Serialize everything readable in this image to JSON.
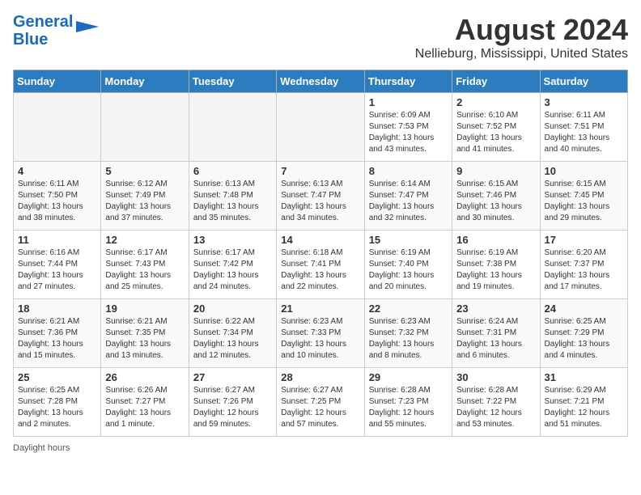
{
  "header": {
    "logo_line1": "General",
    "logo_line2": "Blue",
    "main_title": "August 2024",
    "subtitle": "Nellieburg, Mississippi, United States"
  },
  "footer": {
    "daylight_label": "Daylight hours"
  },
  "days_of_week": [
    "Sunday",
    "Monday",
    "Tuesday",
    "Wednesday",
    "Thursday",
    "Friday",
    "Saturday"
  ],
  "weeks": [
    [
      {
        "day": "",
        "info": ""
      },
      {
        "day": "",
        "info": ""
      },
      {
        "day": "",
        "info": ""
      },
      {
        "day": "",
        "info": ""
      },
      {
        "day": "1",
        "info": "Sunrise: 6:09 AM\nSunset: 7:53 PM\nDaylight: 13 hours\nand 43 minutes."
      },
      {
        "day": "2",
        "info": "Sunrise: 6:10 AM\nSunset: 7:52 PM\nDaylight: 13 hours\nand 41 minutes."
      },
      {
        "day": "3",
        "info": "Sunrise: 6:11 AM\nSunset: 7:51 PM\nDaylight: 13 hours\nand 40 minutes."
      }
    ],
    [
      {
        "day": "4",
        "info": "Sunrise: 6:11 AM\nSunset: 7:50 PM\nDaylight: 13 hours\nand 38 minutes."
      },
      {
        "day": "5",
        "info": "Sunrise: 6:12 AM\nSunset: 7:49 PM\nDaylight: 13 hours\nand 37 minutes."
      },
      {
        "day": "6",
        "info": "Sunrise: 6:13 AM\nSunset: 7:48 PM\nDaylight: 13 hours\nand 35 minutes."
      },
      {
        "day": "7",
        "info": "Sunrise: 6:13 AM\nSunset: 7:47 PM\nDaylight: 13 hours\nand 34 minutes."
      },
      {
        "day": "8",
        "info": "Sunrise: 6:14 AM\nSunset: 7:47 PM\nDaylight: 13 hours\nand 32 minutes."
      },
      {
        "day": "9",
        "info": "Sunrise: 6:15 AM\nSunset: 7:46 PM\nDaylight: 13 hours\nand 30 minutes."
      },
      {
        "day": "10",
        "info": "Sunrise: 6:15 AM\nSunset: 7:45 PM\nDaylight: 13 hours\nand 29 minutes."
      }
    ],
    [
      {
        "day": "11",
        "info": "Sunrise: 6:16 AM\nSunset: 7:44 PM\nDaylight: 13 hours\nand 27 minutes."
      },
      {
        "day": "12",
        "info": "Sunrise: 6:17 AM\nSunset: 7:43 PM\nDaylight: 13 hours\nand 25 minutes."
      },
      {
        "day": "13",
        "info": "Sunrise: 6:17 AM\nSunset: 7:42 PM\nDaylight: 13 hours\nand 24 minutes."
      },
      {
        "day": "14",
        "info": "Sunrise: 6:18 AM\nSunset: 7:41 PM\nDaylight: 13 hours\nand 22 minutes."
      },
      {
        "day": "15",
        "info": "Sunrise: 6:19 AM\nSunset: 7:40 PM\nDaylight: 13 hours\nand 20 minutes."
      },
      {
        "day": "16",
        "info": "Sunrise: 6:19 AM\nSunset: 7:38 PM\nDaylight: 13 hours\nand 19 minutes."
      },
      {
        "day": "17",
        "info": "Sunrise: 6:20 AM\nSunset: 7:37 PM\nDaylight: 13 hours\nand 17 minutes."
      }
    ],
    [
      {
        "day": "18",
        "info": "Sunrise: 6:21 AM\nSunset: 7:36 PM\nDaylight: 13 hours\nand 15 minutes."
      },
      {
        "day": "19",
        "info": "Sunrise: 6:21 AM\nSunset: 7:35 PM\nDaylight: 13 hours\nand 13 minutes."
      },
      {
        "day": "20",
        "info": "Sunrise: 6:22 AM\nSunset: 7:34 PM\nDaylight: 13 hours\nand 12 minutes."
      },
      {
        "day": "21",
        "info": "Sunrise: 6:23 AM\nSunset: 7:33 PM\nDaylight: 13 hours\nand 10 minutes."
      },
      {
        "day": "22",
        "info": "Sunrise: 6:23 AM\nSunset: 7:32 PM\nDaylight: 13 hours\nand 8 minutes."
      },
      {
        "day": "23",
        "info": "Sunrise: 6:24 AM\nSunset: 7:31 PM\nDaylight: 13 hours\nand 6 minutes."
      },
      {
        "day": "24",
        "info": "Sunrise: 6:25 AM\nSunset: 7:29 PM\nDaylight: 13 hours\nand 4 minutes."
      }
    ],
    [
      {
        "day": "25",
        "info": "Sunrise: 6:25 AM\nSunset: 7:28 PM\nDaylight: 13 hours\nand 2 minutes."
      },
      {
        "day": "26",
        "info": "Sunrise: 6:26 AM\nSunset: 7:27 PM\nDaylight: 13 hours\nand 1 minute."
      },
      {
        "day": "27",
        "info": "Sunrise: 6:27 AM\nSunset: 7:26 PM\nDaylight: 12 hours\nand 59 minutes."
      },
      {
        "day": "28",
        "info": "Sunrise: 6:27 AM\nSunset: 7:25 PM\nDaylight: 12 hours\nand 57 minutes."
      },
      {
        "day": "29",
        "info": "Sunrise: 6:28 AM\nSunset: 7:23 PM\nDaylight: 12 hours\nand 55 minutes."
      },
      {
        "day": "30",
        "info": "Sunrise: 6:28 AM\nSunset: 7:22 PM\nDaylight: 12 hours\nand 53 minutes."
      },
      {
        "day": "31",
        "info": "Sunrise: 6:29 AM\nSunset: 7:21 PM\nDaylight: 12 hours\nand 51 minutes."
      }
    ]
  ]
}
